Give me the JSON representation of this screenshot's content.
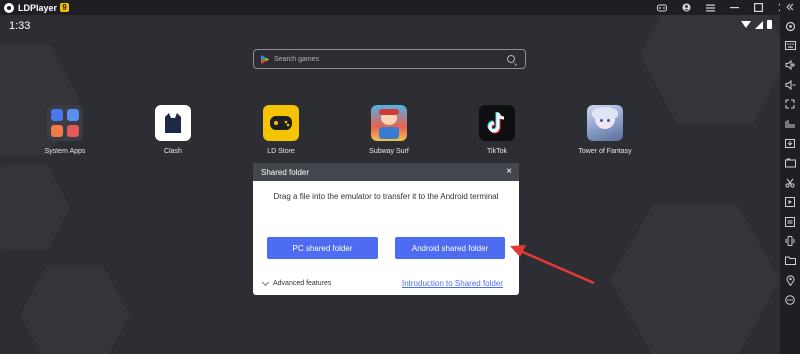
{
  "titlebar": {
    "app_name": "LDPlayer",
    "version_badge": "9",
    "controls": [
      "gamepad-icon",
      "account-icon",
      "menu-icon",
      "minimize-icon",
      "maximize-icon",
      "close-icon"
    ],
    "collapse_icon": "double-chevron-left-icon"
  },
  "status": {
    "time": "1:33"
  },
  "search": {
    "placeholder": "Search games"
  },
  "apps": [
    {
      "label": "System Apps",
      "icon": "system-apps-folder-icon"
    },
    {
      "label": "Clash",
      "icon": "clash-cat-icon"
    },
    {
      "label": "LD Store",
      "icon": "ld-store-icon"
    },
    {
      "label": "Subway Surf",
      "icon": "subway-surf-icon"
    },
    {
      "label": "TikTok",
      "icon": "tiktok-icon"
    },
    {
      "label": "Tower of Fantasy",
      "icon": "tower-of-fantasy-icon"
    }
  ],
  "dialog": {
    "title": "Shared folder",
    "message": "Drag a file into the emulator to transfer it to the Android terminal",
    "pc_button": "PC shared folder",
    "android_button": "Android shared folder",
    "advanced": "Advanced features",
    "intro_link": "Introduction to Shared folder"
  },
  "sidebar": [
    "settings-icon",
    "keyboard-icon",
    "volume-up-icon",
    "volume-down-icon",
    "fullscreen-icon",
    "screenshot-icon",
    "apk-install-icon",
    "record-icon",
    "scissors-icon",
    "operation-record-icon",
    "sync-icon",
    "shake-icon",
    "folder-icon",
    "location-icon",
    "more-icon"
  ],
  "colors": {
    "accent": "#4e6cf1",
    "badge": "#f2c100",
    "arrow": "#e53935"
  }
}
